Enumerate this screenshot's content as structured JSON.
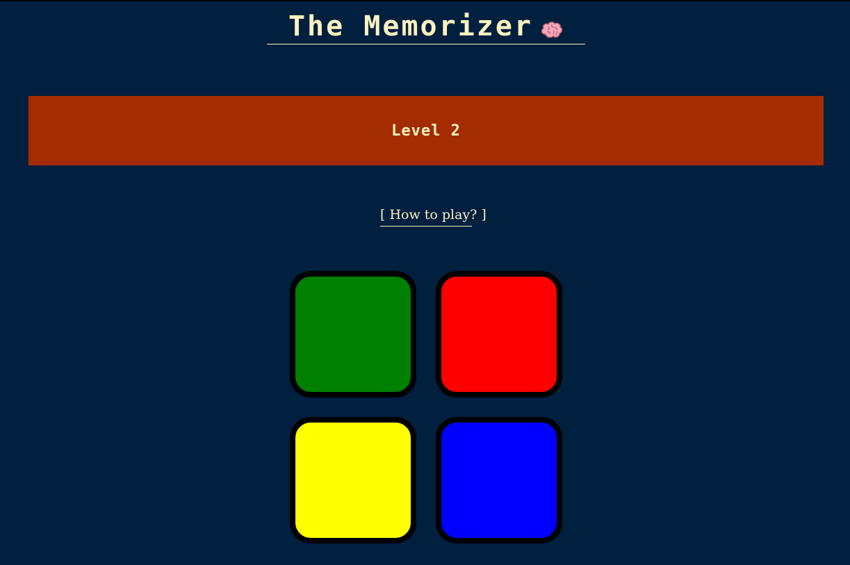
{
  "header": {
    "title": "The Memorizer",
    "icon": "brain-icon"
  },
  "level": {
    "label": "Level 2"
  },
  "help": {
    "link_label": "[ How to play? ]"
  },
  "pads": [
    {
      "name": "green",
      "color": "#008000"
    },
    {
      "name": "red",
      "color": "#ff0000"
    },
    {
      "name": "yellow",
      "color": "#ffff00"
    },
    {
      "name": "blue",
      "color": "#0000ff"
    }
  ],
  "colors": {
    "background": "#011f3f",
    "accent_text": "#fef2bf",
    "banner": "#a32c00",
    "pad_border": "#000000"
  }
}
